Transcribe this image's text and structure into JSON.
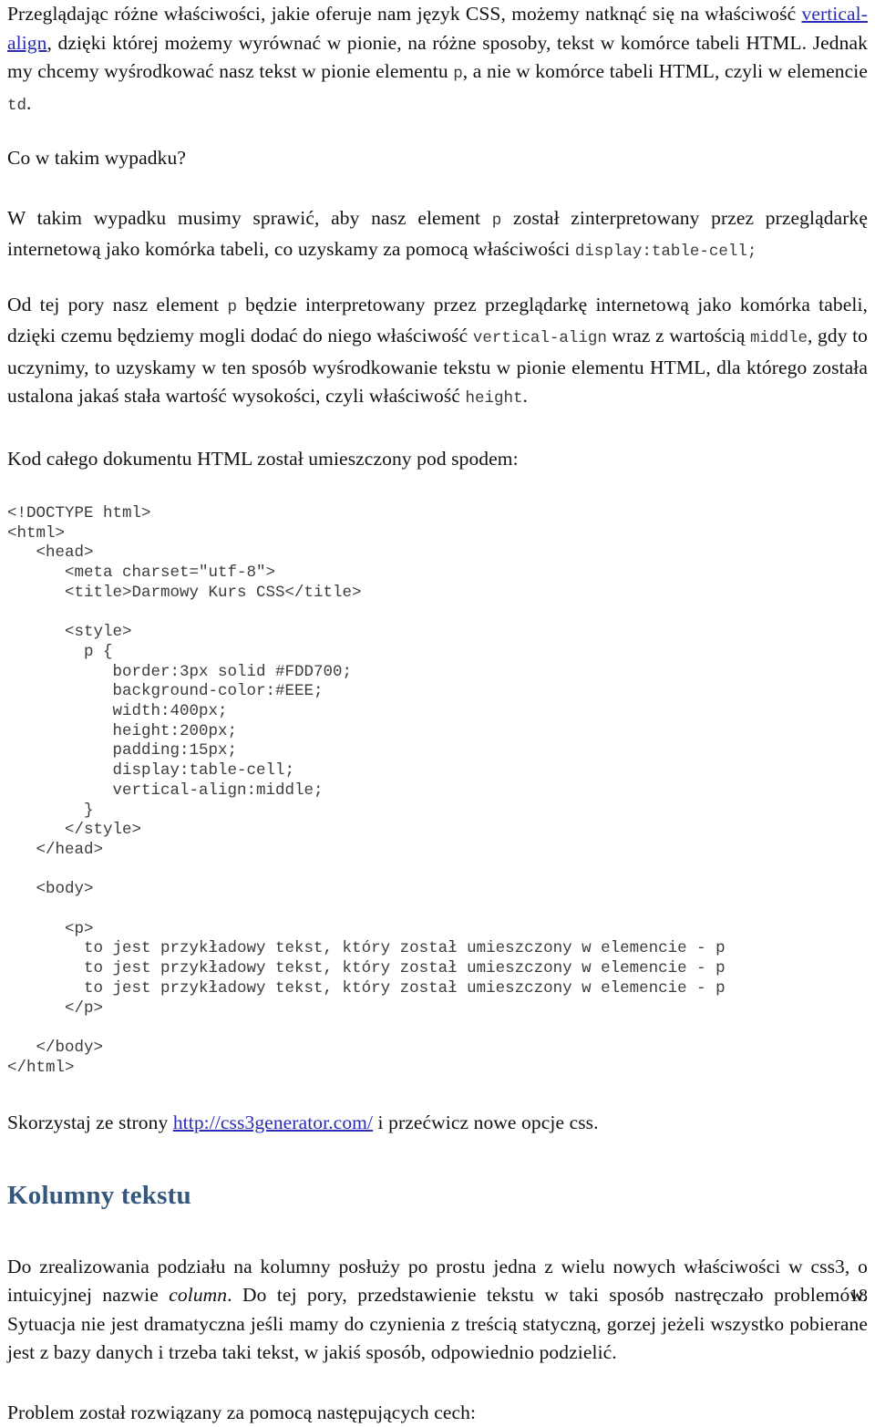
{
  "document": {
    "language": "pl",
    "page_number": "18",
    "link_color": "#2b2bb5",
    "heading_color": "#35577d",
    "code_color": "#3c3c3c"
  },
  "paragraphs": {
    "p1_part1": "Przeglądając różne właściwości, jakie oferuje nam język CSS, możemy natknąć się na właściwość ",
    "p1_link": "vertical-align",
    "p1_part2": ", dzięki której możemy wyrównać w pionie, na różne sposoby, tekst w komórce tabeli HTML. Jednak my chcemy wyśrodkować nasz tekst w pionie elementu ",
    "p1_code1": "p",
    "p1_part3": ", a nie w komórce tabeli HTML, czyli w elemencie ",
    "p1_code2": "td",
    "p1_part4": ".",
    "p2": "Co w takim wypadku?",
    "p3_part1": "W takim wypadku musimy sprawić, aby nasz element ",
    "p3_code1": "p",
    "p3_part2": " został zinterpretowany przez przeglądarkę internetową jako komórka tabeli, co uzyskamy za pomocą właściwości ",
    "p3_code2": "display:table-cell;",
    "p4_part1": "Od tej pory nasz element ",
    "p4_code1": "p",
    "p4_part2": " będzie interpretowany przez przeglądarkę internetową jako komórka tabeli, dzięki czemu będziemy mogli dodać do niego właściwość ",
    "p4_code2": "vertical-align",
    "p4_part3": " wraz z wartością ",
    "p4_code3": "middle",
    "p4_part4": ", gdy to uczynimy, to uzyskamy w ten sposób wyśrodkowanie tekstu w pionie elementu HTML, dla którego została ustalona jakaś stała wartość wysokości, czyli właściwość ",
    "p4_code4": "height",
    "p4_part5": ".",
    "p5": "Kod całego dokumentu HTML został umieszczony pod spodem:",
    "p6_part1": "Skorzystaj ze strony ",
    "p6_link": "http://css3generator.com/",
    "p6_part2": " i przećwicz nowe opcje css.",
    "p7_part1": "Do zrealizowania podziału na kolumny posłuży po prostu jedna z wielu nowych właściwości w css3, o intuicyjnej nazwie ",
    "p7_italic": "column",
    "p7_part2": ". Do tej pory, przedstawienie tekstu w taki sposób nastręczało problemów. Sytuacja nie jest dramatyczna jeśli mamy do czynienia z treścią statyczną, gorzej jeżeli wszystko pobierane jest z bazy danych i trzeba taki tekst, w jakiś sposób, odpowiednio podzielić.",
    "p8": "Problem został rozwiązany za pomocą następujących cech:"
  },
  "heading": {
    "kolumny_tekstu": "Kolumny tekstu"
  },
  "code_block": {
    "language": "html",
    "text": "<!DOCTYPE html>\n<html>\n   <head>\n      <meta charset=\"utf-8\">\n      <title>Darmowy Kurs CSS</title>\n\n      <style>\n        p {\n           border:3px solid #FDD700;\n           background-color:#EEE;\n           width:400px;\n           height:200px;\n           padding:15px;\n           display:table-cell;\n           vertical-align:middle;\n        }\n      </style>\n   </head>\n\n   <body>\n\n      <p>\n        to jest przykładowy tekst, który został umieszczony w elemencie - p\n        to jest przykładowy tekst, który został umieszczony w elemencie - p\n        to jest przykładowy tekst, który został umieszczony w elemencie - p\n      </p>\n\n   </body>\n</html>"
  }
}
